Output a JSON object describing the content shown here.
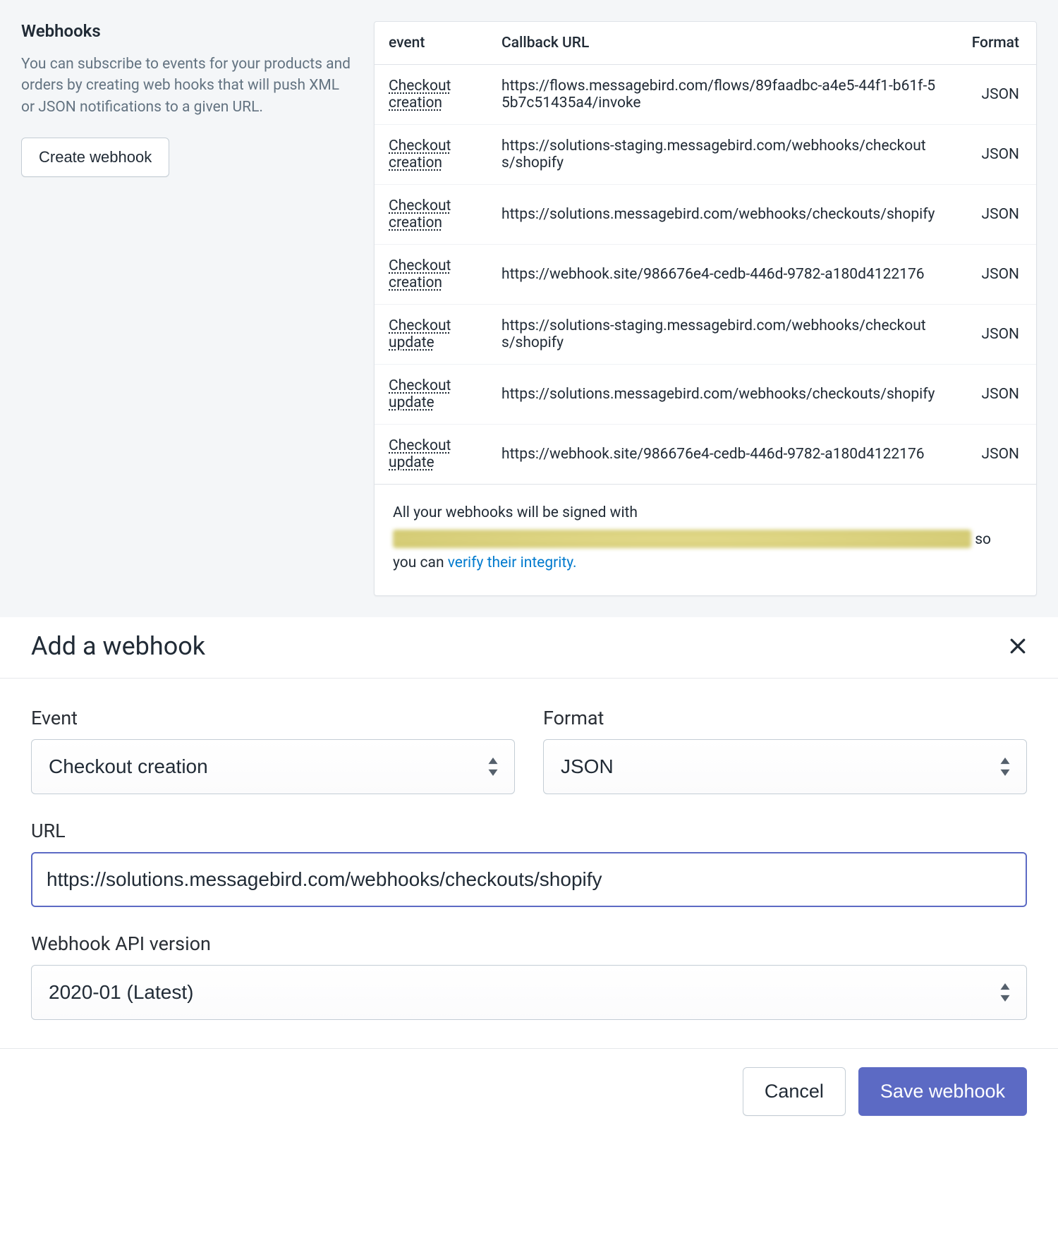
{
  "sidebar": {
    "title": "Webhooks",
    "description": "You can subscribe to events for your products and orders by creating web hooks that will push XML or JSON notifications to a given URL.",
    "create_button_label": "Create webhook"
  },
  "table": {
    "headers": {
      "event": "event",
      "callback_url": "Callback URL",
      "format": "Format"
    },
    "rows": [
      {
        "event": "Checkout creation",
        "url": "https://flows.messagebird.com/flows/89faadbc-a4e5-44f1-b61f-55b7c51435a4/invoke",
        "format": "JSON"
      },
      {
        "event": "Checkout creation",
        "url": "https://solutions-staging.messagebird.com/webhooks/checkouts/shopify",
        "format": "JSON"
      },
      {
        "event": "Checkout creation",
        "url": "https://solutions.messagebird.com/webhooks/checkouts/shopify",
        "format": "JSON"
      },
      {
        "event": "Checkout creation",
        "url": "https://webhook.site/986676e4-cedb-446d-9782-a180d4122176",
        "format": "JSON"
      },
      {
        "event": "Checkout update",
        "url": "https://solutions-staging.messagebird.com/webhooks/checkouts/shopify",
        "format": "JSON"
      },
      {
        "event": "Checkout update",
        "url": "https://solutions.messagebird.com/webhooks/checkouts/shopify",
        "format": "JSON"
      },
      {
        "event": "Checkout update",
        "url": "https://webhook.site/986676e4-cedb-446d-9782-a180d4122176",
        "format": "JSON"
      }
    ]
  },
  "signing": {
    "prefix": "All your webhooks will be signed with",
    "suffix_before_link": "so you can ",
    "verify_link_label": "verify their integrity.",
    "period": ""
  },
  "modal": {
    "title": "Add a webhook",
    "event_label": "Event",
    "format_label": "Format",
    "url_label": "URL",
    "api_version_label": "Webhook API version",
    "event_value": "Checkout creation",
    "format_value": "JSON",
    "url_value": "https://solutions.messagebird.com/webhooks/checkouts/shopify",
    "api_version_value": "2020-01 (Latest)",
    "cancel_label": "Cancel",
    "save_label": "Save webhook"
  }
}
